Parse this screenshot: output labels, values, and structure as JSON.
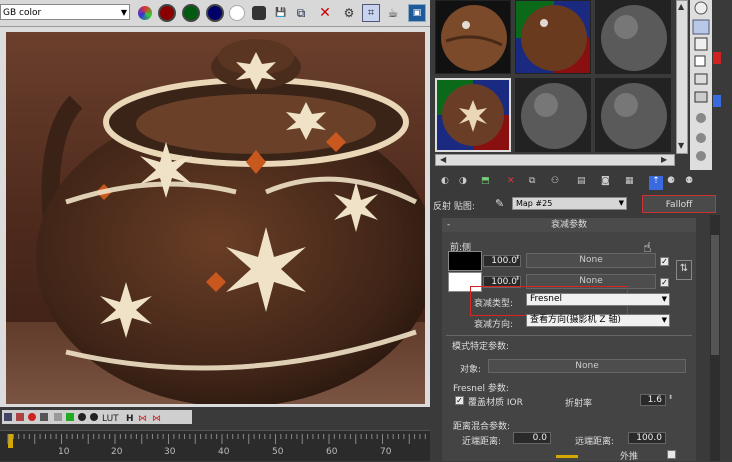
{
  "vfb": {
    "channel": "GB color",
    "timeline_ticks": [
      "10",
      "20",
      "30",
      "40",
      "50",
      "60",
      "70"
    ]
  },
  "material_editor": {
    "map_label": "反射 贴图:",
    "map_name": "Map #25",
    "map_type": "Falloff",
    "rollout_title": "衰减参数",
    "front_side_label": "前:侧",
    "row1": {
      "value": "100.0",
      "map": "None"
    },
    "row2": {
      "value": "100.0",
      "map": "None"
    },
    "falloff_type_label": "衰减类型:",
    "falloff_type_value": "Fresnel",
    "falloff_dir_label": "衰减方向:",
    "falloff_dir_value": "查看方向(摄影机 Z 轴)",
    "mode_section_title": "模式特定参数:",
    "object_label": "对象:",
    "object_value": "None",
    "fresnel_params_label": "Fresnel 参数:",
    "override_ior_label": "覆盖材质 IOR",
    "ior_label": "折射率",
    "ior_value": "1.6",
    "distance_section_label": "距离混合参数:",
    "near_label": "近端距离:",
    "near_value": "0.0",
    "far_label": "远端距离:",
    "far_value": "100.0",
    "extrapolate_label": "外推"
  },
  "colors": {
    "accent_red": "#d22222",
    "panel_bg": "#3a3a3a",
    "toolbar_bg": "#d8d8d8"
  }
}
